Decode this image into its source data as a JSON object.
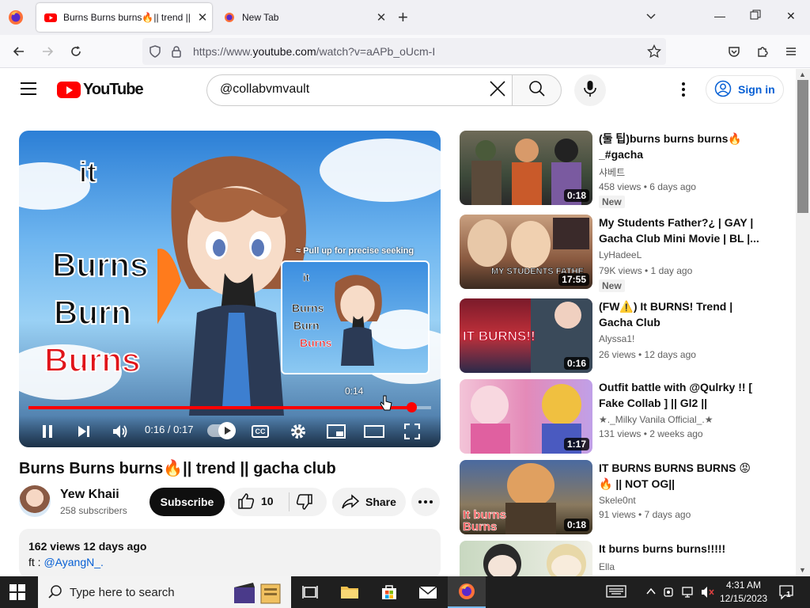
{
  "browser": {
    "tabs": [
      {
        "title": "Burns Burns burns🔥|| trend || g",
        "active": true
      },
      {
        "title": "New Tab",
        "active": false
      }
    ],
    "url_prefix": "https://www.",
    "url_domain": "youtube.com",
    "url_path": "/watch?v=aAPb_oUcm-I"
  },
  "youtube": {
    "logo_text": "YouTube",
    "search_value": "@collabvmvault",
    "sign_in": "Sign in"
  },
  "player": {
    "overlay_words": [
      "it",
      "Burns",
      "Burn",
      "Burns"
    ],
    "preview_hint": "≈ Pull up for precise seeking",
    "preview_time": "0:14",
    "preview_words": [
      "it",
      "Burns",
      "Burn",
      "Burns"
    ],
    "time_current": "0:16",
    "time_total": "0:17",
    "time_display": "0:16 / 0:17",
    "progress_fraction": 0.951,
    "hover_fraction": 0.88
  },
  "video": {
    "title": "Burns Burns burns🔥|| trend || gacha club",
    "channel": "Yew Khaii",
    "subscribers": "258 subscribers",
    "subscribe_label": "Subscribe",
    "likes": "10",
    "share_label": "Share",
    "views_date": "162 views  12 days ago",
    "description_prefix": "ft : ",
    "description_link": "@AyangN_."
  },
  "recommendations": [
    {
      "title": "(둘 팁)burns burns burns🔥 _#gacha",
      "channel": "샤베트",
      "meta": "458 views  • 6 days ago",
      "badge": "New",
      "duration": "0:18"
    },
    {
      "title": "My Students Father?¿ | GAY | Gacha Club Mini Movie | BL |...",
      "channel": "LyHadeeL",
      "meta": "79K views  • 1 day ago",
      "badge": "New",
      "duration": "17:55",
      "thumb_text": "MY STUDENTS FATHE"
    },
    {
      "title": "(FW⚠️) It BURNS! Trend | Gacha Club",
      "channel": "Alyssa1!",
      "meta": "26 views  • 12 days ago",
      "badge": "",
      "duration": "0:16",
      "thumb_text": "IT BURNS!!"
    },
    {
      "title": "Outfit battle with @Qulrky !! [ Fake Collab ] || Gl2 ||",
      "channel": "★._Milky Vanila Official_.★",
      "meta": "131 views  • 2 weeks ago",
      "badge": "",
      "duration": "1:17"
    },
    {
      "title": "IT BURNS BURNS BURNS 😡 🔥 || NOT OG||",
      "channel": "Skele0nt",
      "meta": "91 views  • 7 days ago",
      "badge": "",
      "duration": "0:18",
      "thumb_text": "It burns Burns"
    },
    {
      "title": "It burns burns burns!!!!!",
      "channel": "Ella",
      "meta": "",
      "badge": "",
      "duration": ""
    }
  ],
  "taskbar": {
    "search_placeholder": "Type here to search",
    "time": "4:31 AM",
    "date": "12/15/2023",
    "notification_count": "1"
  },
  "colors": {
    "yt_red": "#ff0000",
    "link_blue": "#065fd4",
    "taskbar": "#1f1f1f"
  }
}
